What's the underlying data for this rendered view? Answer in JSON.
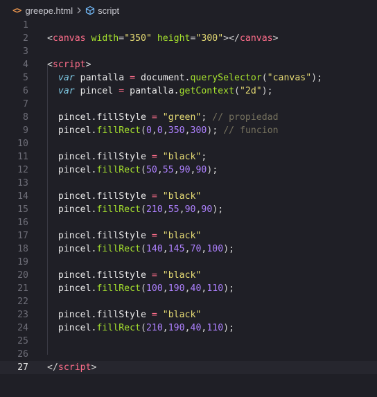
{
  "breadcrumb": {
    "file_icon": "<>",
    "file_name": "greepe.html",
    "separator": ">",
    "symbol_name": "script"
  },
  "icons": {
    "file": "html-code-icon",
    "separator": "chevron-right-icon",
    "symbol": "cube-symbol-icon"
  },
  "colors": {
    "background": "#1f1f26",
    "active_line": "#26262e",
    "tag": "#ff6e8b",
    "attribute": "#a6e22e",
    "string": "#e6db74",
    "keyword": "#7ec8e3",
    "number": "#ae81ff",
    "comment": "#75715e"
  },
  "editor": {
    "active_line": 27,
    "lines": [
      {
        "n": "1",
        "tokens": []
      },
      {
        "n": "2",
        "tokens": [
          [
            "punct",
            "<"
          ],
          [
            "tag",
            "canvas"
          ],
          [
            "punct",
            " "
          ],
          [
            "attr",
            "width"
          ],
          [
            "punct",
            "="
          ],
          [
            "str",
            "\"350\""
          ],
          [
            "punct",
            " "
          ],
          [
            "attr",
            "height"
          ],
          [
            "punct",
            "="
          ],
          [
            "str",
            "\"300\""
          ],
          [
            "punct",
            "></"
          ],
          [
            "tag",
            "canvas"
          ],
          [
            "punct",
            ">"
          ]
        ]
      },
      {
        "n": "3",
        "tokens": []
      },
      {
        "n": "4",
        "tokens": [
          [
            "punct",
            "<"
          ],
          [
            "tag",
            "script"
          ],
          [
            "punct",
            ">"
          ]
        ]
      },
      {
        "n": "5",
        "tokens": [
          [
            "punct",
            "  "
          ],
          [
            "kw",
            "var"
          ],
          [
            "var",
            " pantalla "
          ],
          [
            "op",
            "="
          ],
          [
            "var",
            " document."
          ],
          [
            "fn",
            "querySelector"
          ],
          [
            "punct",
            "("
          ],
          [
            "str",
            "\"canvas\""
          ],
          [
            "punct",
            ");"
          ]
        ]
      },
      {
        "n": "6",
        "tokens": [
          [
            "punct",
            "  "
          ],
          [
            "kw",
            "var"
          ],
          [
            "var",
            " pincel "
          ],
          [
            "op",
            "="
          ],
          [
            "var",
            " pantalla."
          ],
          [
            "fn",
            "getContext"
          ],
          [
            "punct",
            "("
          ],
          [
            "str",
            "\"2d\""
          ],
          [
            "punct",
            ");"
          ]
        ]
      },
      {
        "n": "7",
        "tokens": []
      },
      {
        "n": "8",
        "tokens": [
          [
            "punct",
            "  "
          ],
          [
            "var",
            "pincel.fillStyle "
          ],
          [
            "op",
            "="
          ],
          [
            "punct",
            " "
          ],
          [
            "str",
            "\"green\""
          ],
          [
            "punct",
            "; "
          ],
          [
            "comment",
            "// propiedad"
          ]
        ]
      },
      {
        "n": "9",
        "tokens": [
          [
            "punct",
            "  "
          ],
          [
            "var",
            "pincel."
          ],
          [
            "fn",
            "fillRect"
          ],
          [
            "punct",
            "("
          ],
          [
            "num",
            "0"
          ],
          [
            "punct",
            ","
          ],
          [
            "num",
            "0"
          ],
          [
            "punct",
            ","
          ],
          [
            "num",
            "350"
          ],
          [
            "punct",
            ","
          ],
          [
            "num",
            "300"
          ],
          [
            "punct",
            "); "
          ],
          [
            "comment",
            "// funcion"
          ]
        ]
      },
      {
        "n": "10",
        "tokens": []
      },
      {
        "n": "11",
        "tokens": [
          [
            "punct",
            "  "
          ],
          [
            "var",
            "pincel.fillStyle "
          ],
          [
            "op",
            "="
          ],
          [
            "punct",
            " "
          ],
          [
            "str",
            "\"black\""
          ],
          [
            "punct",
            ";"
          ]
        ]
      },
      {
        "n": "12",
        "tokens": [
          [
            "punct",
            "  "
          ],
          [
            "var",
            "pincel."
          ],
          [
            "fn",
            "fillRect"
          ],
          [
            "punct",
            "("
          ],
          [
            "num",
            "50"
          ],
          [
            "punct",
            ","
          ],
          [
            "num",
            "55"
          ],
          [
            "punct",
            ","
          ],
          [
            "num",
            "90"
          ],
          [
            "punct",
            ","
          ],
          [
            "num",
            "90"
          ],
          [
            "punct",
            ");"
          ]
        ]
      },
      {
        "n": "13",
        "tokens": []
      },
      {
        "n": "14",
        "tokens": [
          [
            "punct",
            "  "
          ],
          [
            "var",
            "pincel.fillStyle "
          ],
          [
            "op",
            "="
          ],
          [
            "punct",
            " "
          ],
          [
            "str",
            "\"black\""
          ]
        ]
      },
      {
        "n": "15",
        "tokens": [
          [
            "punct",
            "  "
          ],
          [
            "var",
            "pincel."
          ],
          [
            "fn",
            "fillRect"
          ],
          [
            "punct",
            "("
          ],
          [
            "num",
            "210"
          ],
          [
            "punct",
            ","
          ],
          [
            "num",
            "55"
          ],
          [
            "punct",
            ","
          ],
          [
            "num",
            "90"
          ],
          [
            "punct",
            ","
          ],
          [
            "num",
            "90"
          ],
          [
            "punct",
            ");"
          ]
        ]
      },
      {
        "n": "16",
        "tokens": []
      },
      {
        "n": "17",
        "tokens": [
          [
            "punct",
            "  "
          ],
          [
            "var",
            "pincel.fillStyle "
          ],
          [
            "op",
            "="
          ],
          [
            "punct",
            " "
          ],
          [
            "str",
            "\"black\""
          ]
        ]
      },
      {
        "n": "18",
        "tokens": [
          [
            "punct",
            "  "
          ],
          [
            "var",
            "pincel."
          ],
          [
            "fn",
            "fillRect"
          ],
          [
            "punct",
            "("
          ],
          [
            "num",
            "140"
          ],
          [
            "punct",
            ","
          ],
          [
            "num",
            "145"
          ],
          [
            "punct",
            ","
          ],
          [
            "num",
            "70"
          ],
          [
            "punct",
            ","
          ],
          [
            "num",
            "100"
          ],
          [
            "punct",
            ");"
          ]
        ]
      },
      {
        "n": "19",
        "tokens": []
      },
      {
        "n": "20",
        "tokens": [
          [
            "punct",
            "  "
          ],
          [
            "var",
            "pincel.fillStyle "
          ],
          [
            "op",
            "="
          ],
          [
            "punct",
            " "
          ],
          [
            "str",
            "\"black\""
          ]
        ]
      },
      {
        "n": "21",
        "tokens": [
          [
            "punct",
            "  "
          ],
          [
            "var",
            "pincel."
          ],
          [
            "fn",
            "fillRect"
          ],
          [
            "punct",
            "("
          ],
          [
            "num",
            "100"
          ],
          [
            "punct",
            ","
          ],
          [
            "num",
            "190"
          ],
          [
            "punct",
            ","
          ],
          [
            "num",
            "40"
          ],
          [
            "punct",
            ","
          ],
          [
            "num",
            "110"
          ],
          [
            "punct",
            ");"
          ]
        ]
      },
      {
        "n": "22",
        "tokens": []
      },
      {
        "n": "23",
        "tokens": [
          [
            "punct",
            "  "
          ],
          [
            "var",
            "pincel.fillStyle "
          ],
          [
            "op",
            "="
          ],
          [
            "punct",
            " "
          ],
          [
            "str",
            "\"black\""
          ]
        ]
      },
      {
        "n": "24",
        "tokens": [
          [
            "punct",
            "  "
          ],
          [
            "var",
            "pincel."
          ],
          [
            "fn",
            "fillRect"
          ],
          [
            "punct",
            "("
          ],
          [
            "num",
            "210"
          ],
          [
            "punct",
            ","
          ],
          [
            "num",
            "190"
          ],
          [
            "punct",
            ","
          ],
          [
            "num",
            "40"
          ],
          [
            "punct",
            ","
          ],
          [
            "num",
            "110"
          ],
          [
            "punct",
            ");"
          ]
        ]
      },
      {
        "n": "25",
        "tokens": []
      },
      {
        "n": "26",
        "tokens": []
      },
      {
        "n": "27",
        "tokens": [
          [
            "punct",
            "</"
          ],
          [
            "tag",
            "script"
          ],
          [
            "punct",
            ">"
          ]
        ]
      }
    ]
  }
}
